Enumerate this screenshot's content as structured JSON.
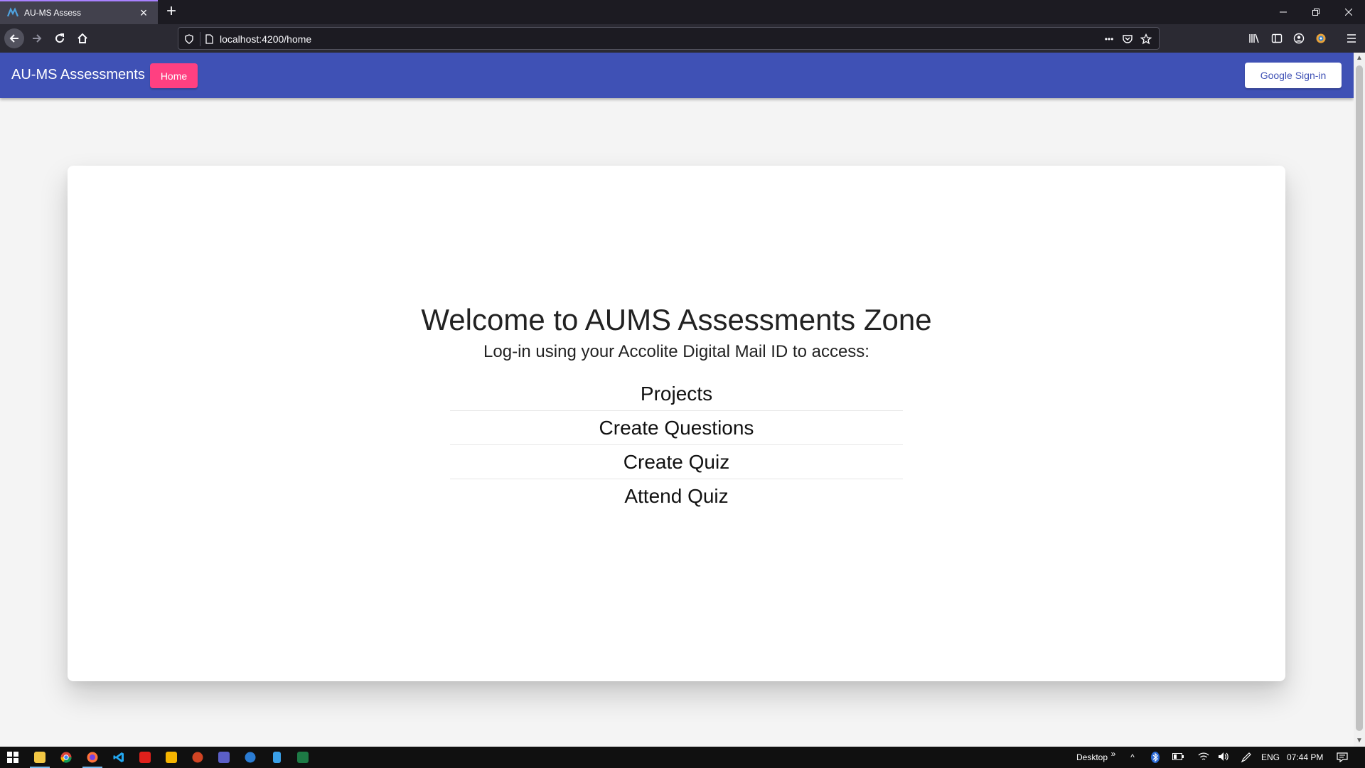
{
  "browser": {
    "tab_title": "AU-MS Assess",
    "url": "localhost:4200/home",
    "url_ellipsis": "•••"
  },
  "app": {
    "title": "AU-MS Assessments",
    "home_label": "Home",
    "signin_label": "Google Sign-in",
    "colors": {
      "primary": "#3f51b5",
      "accent": "#ff4081"
    }
  },
  "card": {
    "heading": "Welcome to AUMS Assessments Zone",
    "subheading": "Log-in using your Accolite Digital Mail ID to access:",
    "items": [
      {
        "label": "Projects"
      },
      {
        "label": "Create Questions"
      },
      {
        "label": "Create Quiz"
      },
      {
        "label": "Attend Quiz"
      }
    ]
  },
  "taskbar": {
    "desktop_label": "Desktop",
    "language": "ENG",
    "time": "07:44 PM",
    "icons": [
      "windows-start-icon",
      "file-explorer-icon",
      "chrome-icon",
      "firefox-icon",
      "vscode-icon",
      "acrobat-icon",
      "folder-icon",
      "powerpoint-icon",
      "teams-icon",
      "word-icon",
      "notepad-icon",
      "excel-icon"
    ]
  }
}
